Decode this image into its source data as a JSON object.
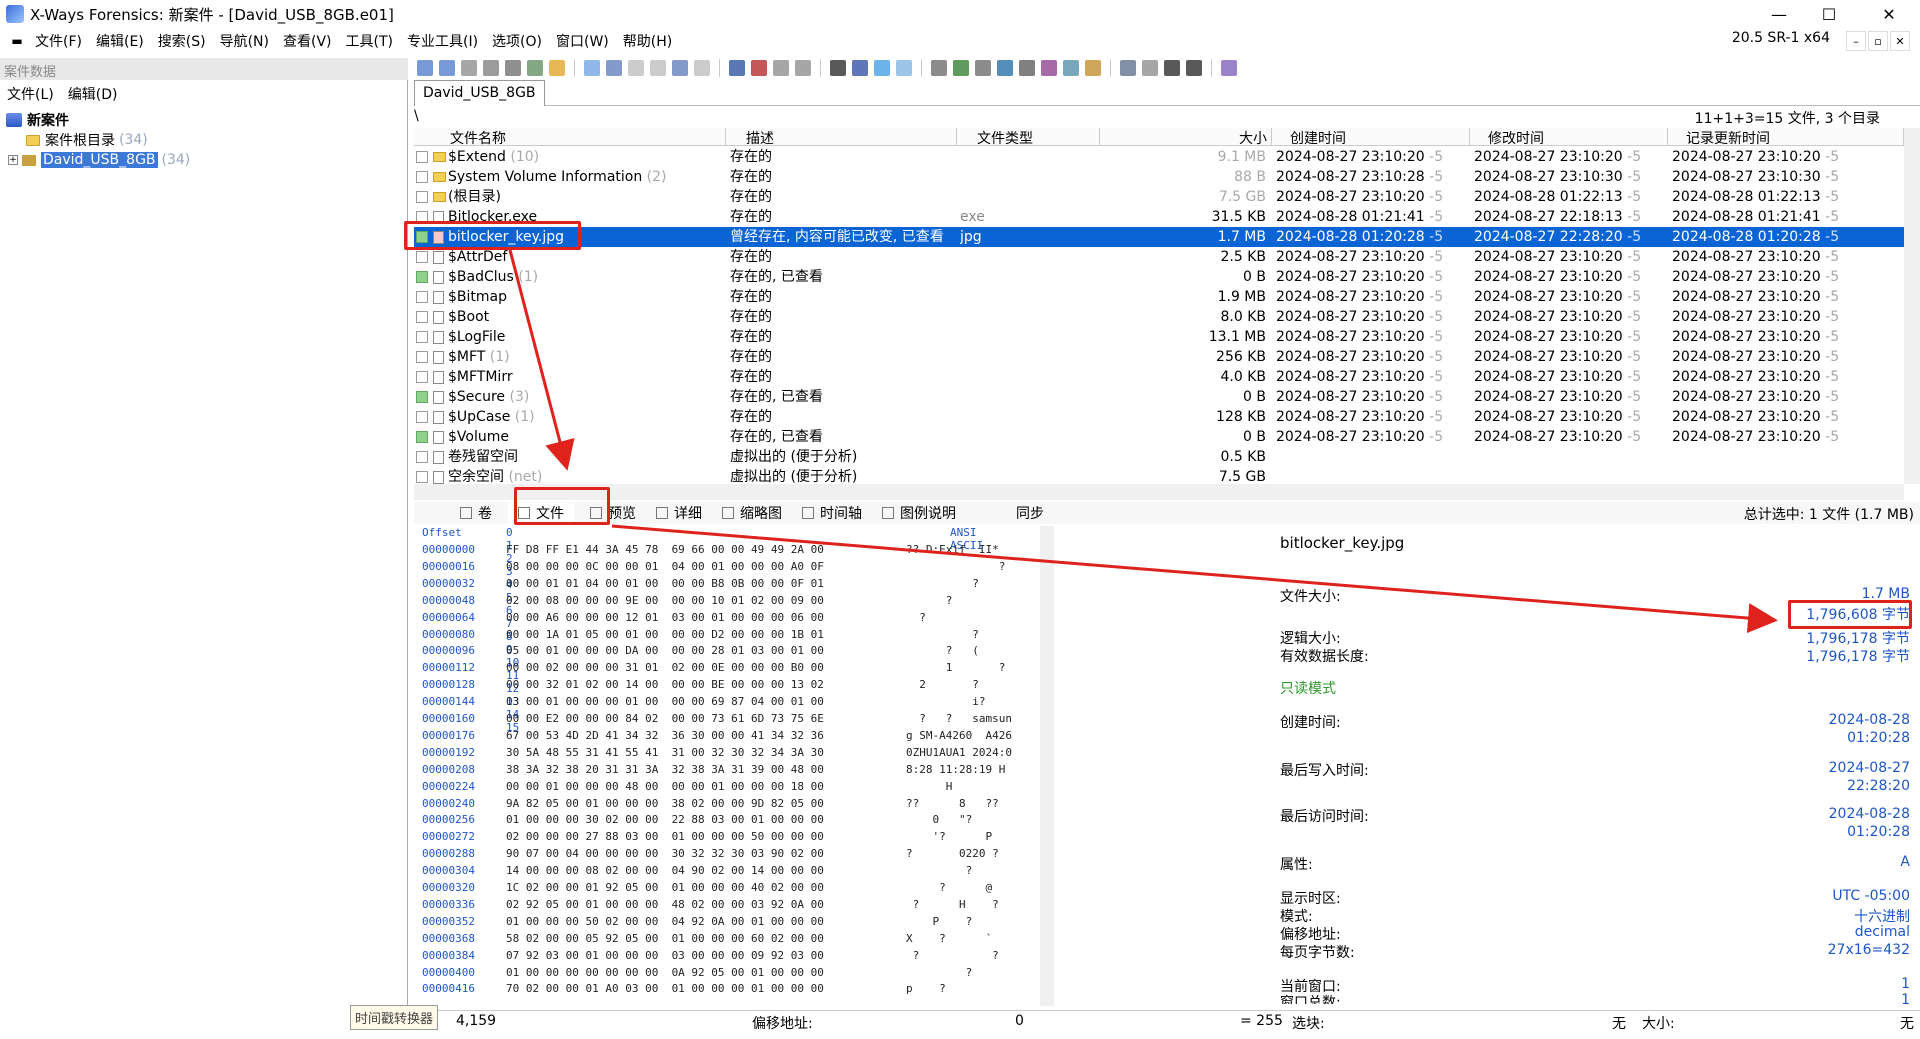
{
  "window": {
    "title": "X-Ways Forensics: 新案件 - [David_USB_8GB.e01]",
    "minimize": "—",
    "maximize": "☐",
    "close": "✕"
  },
  "menu": [
    "文件(F)",
    "编辑(E)",
    "搜索(S)",
    "导航(N)",
    "查看(V)",
    "工具(T)",
    "专业工具(I)",
    "选项(O)",
    "窗口(W)",
    "帮助(H)"
  ],
  "version": "20.5 SR-1 x64",
  "sub_controls": [
    "–",
    "▫",
    "✕"
  ],
  "left": {
    "header": "案件数据",
    "menu": [
      "文件(L)",
      "编辑(D)"
    ],
    "tree": [
      {
        "label": "新案件",
        "count": ""
      },
      {
        "label": "案件根目录",
        "count": "(34)"
      },
      {
        "label": "David_USB_8GB",
        "count": "(34)"
      }
    ]
  },
  "tab": "David_USB_8GB",
  "path": "\\",
  "file_summary": "11+1+3=15 文件, 3 个目录",
  "columns": [
    "文件名称",
    "描述",
    "文件类型",
    "大小",
    "创建时间",
    "修改时间",
    "记录更新时间"
  ],
  "rows": [
    {
      "name": "$Extend",
      "cnt": "(10)",
      "desc": "存在的",
      "type": "",
      "size": "9.1 MB",
      "ctime": "2024-08-27  23:10:20",
      "mtime": "2024-08-27  23:10:20",
      "rtime": "2024-08-27  23:10:20",
      "sz_grey": true,
      "folder": true,
      "green": false
    },
    {
      "name": "System Volume Information",
      "cnt": "(2)",
      "desc": "存在的",
      "type": "",
      "size": "88 B",
      "ctime": "2024-08-27  23:10:28",
      "mtime": "2024-08-27  23:10:30",
      "rtime": "2024-08-27  23:10:30",
      "sz_grey": true,
      "folder": true,
      "green": false
    },
    {
      "name": "(根目录)",
      "cnt": "",
      "desc": "存在的",
      "type": "",
      "size": "7.5 GB",
      "ctime": "2024-08-27  23:10:20",
      "mtime": "2024-08-28  01:22:13",
      "rtime": "2024-08-28  01:22:13",
      "sz_grey": true,
      "folder": true,
      "green": false
    },
    {
      "name": "Bitlocker.exe",
      "cnt": "",
      "desc": "存在的",
      "type": "exe",
      "size": "31.5 KB",
      "ctime": "2024-08-28  01:21:41",
      "mtime": "2024-08-27  22:18:13",
      "rtime": "2024-08-28  01:21:41",
      "sz_grey": false,
      "folder": false,
      "green": false
    },
    {
      "name": "bitlocker_key.jpg",
      "cnt": "",
      "desc": "曾经存在, 内容可能已改变, 已查看",
      "type": "jpg",
      "size": "1.7 MB",
      "ctime": "2024-08-28  01:20:28",
      "mtime": "2024-08-27  22:28:20",
      "rtime": "2024-08-28  01:20:28",
      "sz_grey": false,
      "folder": false,
      "green": true,
      "selected": true
    },
    {
      "name": "$AttrDef",
      "cnt": "",
      "desc": "存在的",
      "type": "",
      "size": "2.5 KB",
      "ctime": "2024-08-27  23:10:20",
      "mtime": "2024-08-27  23:10:20",
      "rtime": "2024-08-27  23:10:20",
      "sz_grey": false,
      "folder": false,
      "green": false
    },
    {
      "name": "$BadClus",
      "cnt": "(1)",
      "desc": "存在的, 已查看",
      "type": "",
      "size": "0 B",
      "ctime": "2024-08-27  23:10:20",
      "mtime": "2024-08-27  23:10:20",
      "rtime": "2024-08-27  23:10:20",
      "sz_grey": false,
      "folder": false,
      "green": true
    },
    {
      "name": "$Bitmap",
      "cnt": "",
      "desc": "存在的",
      "type": "",
      "size": "1.9 MB",
      "ctime": "2024-08-27  23:10:20",
      "mtime": "2024-08-27  23:10:20",
      "rtime": "2024-08-27  23:10:20",
      "sz_grey": false,
      "folder": false,
      "green": false
    },
    {
      "name": "$Boot",
      "cnt": "",
      "desc": "存在的",
      "type": "",
      "size": "8.0 KB",
      "ctime": "2024-08-27  23:10:20",
      "mtime": "2024-08-27  23:10:20",
      "rtime": "2024-08-27  23:10:20",
      "sz_grey": false,
      "folder": false,
      "green": false
    },
    {
      "name": "$LogFile",
      "cnt": "",
      "desc": "存在的",
      "type": "",
      "size": "13.1 MB",
      "ctime": "2024-08-27  23:10:20",
      "mtime": "2024-08-27  23:10:20",
      "rtime": "2024-08-27  23:10:20",
      "sz_grey": false,
      "folder": false,
      "green": false
    },
    {
      "name": "$MFT",
      "cnt": "(1)",
      "desc": "存在的",
      "type": "",
      "size": "256 KB",
      "ctime": "2024-08-27  23:10:20",
      "mtime": "2024-08-27  23:10:20",
      "rtime": "2024-08-27  23:10:20",
      "sz_grey": false,
      "folder": false,
      "green": false
    },
    {
      "name": "$MFTMirr",
      "cnt": "",
      "desc": "存在的",
      "type": "",
      "size": "4.0 KB",
      "ctime": "2024-08-27  23:10:20",
      "mtime": "2024-08-27  23:10:20",
      "rtime": "2024-08-27  23:10:20",
      "sz_grey": false,
      "folder": false,
      "green": false
    },
    {
      "name": "$Secure",
      "cnt": "(3)",
      "desc": "存在的, 已查看",
      "type": "",
      "size": "0 B",
      "ctime": "2024-08-27  23:10:20",
      "mtime": "2024-08-27  23:10:20",
      "rtime": "2024-08-27  23:10:20",
      "sz_grey": false,
      "folder": false,
      "green": true
    },
    {
      "name": "$UpCase",
      "cnt": "(1)",
      "desc": "存在的",
      "type": "",
      "size": "128 KB",
      "ctime": "2024-08-27  23:10:20",
      "mtime": "2024-08-27  23:10:20",
      "rtime": "2024-08-27  23:10:20",
      "sz_grey": false,
      "folder": false,
      "green": false
    },
    {
      "name": "$Volume",
      "cnt": "",
      "desc": "存在的, 已查看",
      "type": "",
      "size": "0 B",
      "ctime": "2024-08-27  23:10:20",
      "mtime": "2024-08-27  23:10:20",
      "rtime": "2024-08-27  23:10:20",
      "sz_grey": false,
      "folder": false,
      "green": true
    },
    {
      "name": "卷残留空间",
      "cnt": "",
      "desc": "虚拟出的 (便于分析)",
      "type": "",
      "size": "0.5 KB",
      "ctime": "",
      "mtime": "",
      "rtime": "",
      "sz_grey": false,
      "folder": false,
      "green": false
    },
    {
      "name": "空余空间",
      "cnt": "(net)",
      "desc": "虚拟出的 (便于分析)",
      "type": "",
      "size": "7.5 GB",
      "ctime": "",
      "mtime": "",
      "rtime": "",
      "sz_grey": false,
      "folder": false,
      "green": false
    }
  ],
  "tz_suffix": "-5",
  "lower_tabs": [
    "卷",
    "文件",
    "预览",
    "详细",
    "缩略图",
    "时间轴",
    "图例说明",
    "同步"
  ],
  "lower_total": "总计选中: 1 文件 (1.7 MB)",
  "hex": {
    "header_offset": "Offset",
    "header_cols": " 0  1  2  3  4  5  6  7   8  9 10 11 12 13 14 15",
    "header_ascii": "ANSI ASCII",
    "rows": [
      [
        "00000000",
        "FF D8 FF E1 44 3A 45 78  69 66 00 00 49 49 2A 00",
        "?? D:Exif  II* "
      ],
      [
        "00000016",
        "08 00 00 00 0C 00 00 01  04 00 01 00 00 00 A0 0F",
        "              ? "
      ],
      [
        "00000032",
        "00 00 01 01 04 00 01 00  00 00 B8 0B 00 00 0F 01",
        "          ?     "
      ],
      [
        "00000048",
        "02 00 08 00 00 00 9E 00  00 00 10 01 02 00 09 00",
        "      ?         "
      ],
      [
        "00000064",
        "00 00 A6 00 00 00 12 01  03 00 01 00 00 00 06 00",
        "  ?             "
      ],
      [
        "00000080",
        "00 00 1A 01 05 00 01 00  00 00 D2 00 00 00 1B 01",
        "          ?     "
      ],
      [
        "00000096",
        "05 00 01 00 00 00 DA 00  00 00 28 01 03 00 01 00",
        "      ?   (     "
      ],
      [
        "00000112",
        "00 00 02 00 00 00 31 01  02 00 0E 00 00 00 B0 00",
        "      1       ? "
      ],
      [
        "00000128",
        "00 00 32 01 02 00 14 00  00 00 BE 00 00 00 13 02",
        "  2       ?     "
      ],
      [
        "00000144",
        "03 00 01 00 00 00 01 00  00 00 69 87 04 00 01 00",
        "          i?    "
      ],
      [
        "00000160",
        "00 00 E2 00 00 00 84 02  00 00 73 61 6D 73 75 6E",
        "  ?   ?   samsun"
      ],
      [
        "00000176",
        "67 00 53 4D 2D 41 34 32  36 30 00 00 41 34 32 36",
        "g SM-A4260  A426"
      ],
      [
        "00000192",
        "30 5A 48 55 31 41 55 41  31 00 32 30 32 34 3A 30",
        "0ZHU1AUA1 2024:0"
      ],
      [
        "00000208",
        "38 3A 32 38 20 31 31 3A  32 38 3A 31 39 00 48 00",
        "8:28 11:28:19 H "
      ],
      [
        "00000224",
        "00 00 01 00 00 00 48 00  00 00 01 00 00 00 18 00",
        "      H         "
      ],
      [
        "00000240",
        "9A 82 05 00 01 00 00 00  38 02 00 00 9D 82 05 00",
        "??      8   ??  "
      ],
      [
        "00000256",
        "01 00 00 00 30 02 00 00  22 88 03 00 01 00 00 00",
        "    0   \"?      "
      ],
      [
        "00000272",
        "02 00 00 00 27 88 03 00  01 00 00 00 50 00 00 00",
        "    '?      P   "
      ],
      [
        "00000288",
        "90 07 00 04 00 00 00 00  30 32 32 30 03 90 02 00",
        "?       0220 ?  "
      ],
      [
        "00000304",
        "14 00 00 00 08 02 00 00  04 90 02 00 14 00 00 00",
        "         ?      "
      ],
      [
        "00000320",
        "1C 02 00 00 01 92 05 00  01 00 00 00 40 02 00 00",
        "     ?      @   "
      ],
      [
        "00000336",
        "02 92 05 00 01 00 00 00  48 02 00 00 03 92 0A 00",
        " ?      H    ?  "
      ],
      [
        "00000352",
        "01 00 00 00 50 02 00 00  04 92 0A 00 01 00 00 00",
        "    P    ?      "
      ],
      [
        "00000368",
        "58 02 00 00 05 92 05 00  01 00 00 00 60 02 00 00",
        "X    ?      `   "
      ],
      [
        "00000384",
        "07 92 03 00 01 00 00 00  03 00 00 00 09 92 03 00",
        " ?           ?  "
      ],
      [
        "00000400",
        "01 00 00 00 00 00 00 00  0A 92 05 00 01 00 00 00",
        "         ?      "
      ],
      [
        "00000416",
        "70 02 00 00 01 A0 03 00  01 00 00 00 01 00 00 00",
        "p    ?          "
      ]
    ]
  },
  "info": {
    "filename": "bitlocker_key.jpg",
    "size_label": "文件大小:",
    "size_mb": "1.7 MB",
    "size_bytes": "1,796,608 字节",
    "logical_label": "逻辑大小:",
    "logical": "1,796,178 字节",
    "valid_label": "有效数据长度:",
    "valid": "1,796,178 字节",
    "readonly": "只读模式",
    "ctime_label": "创建时间:",
    "ctime_d": "2024-08-28",
    "ctime_t": "01:20:28",
    "wtime_label": "最后写入时间:",
    "wtime_d": "2024-08-27",
    "wtime_t": "22:28:20",
    "atime_label": "最后访问时间:",
    "atime_d": "2024-08-28",
    "atime_t": "01:20:28",
    "attr_label": "属性:",
    "attr": "A",
    "tz_label": "显示时区:",
    "tz": "UTC -05:00",
    "mode_label": "模式:",
    "mode": "十六进制",
    "offset_label": "偏移地址:",
    "offset": "decimal",
    "bpp_label": "每页字节数:",
    "bpp": "27x16=432",
    "curwin_label": "当前窗口:",
    "curwin": "1",
    "totwin_label": "窗口总数:",
    "totwin": "1"
  },
  "status": {
    "left": "4,159",
    "offset_label": "偏移地址:",
    "offset": "0",
    "eq": "= 255",
    "sel_label": "选块:",
    "sel": "无",
    "size_label": "大小:",
    "size": "无"
  },
  "tooltip": "时间戳转换器"
}
